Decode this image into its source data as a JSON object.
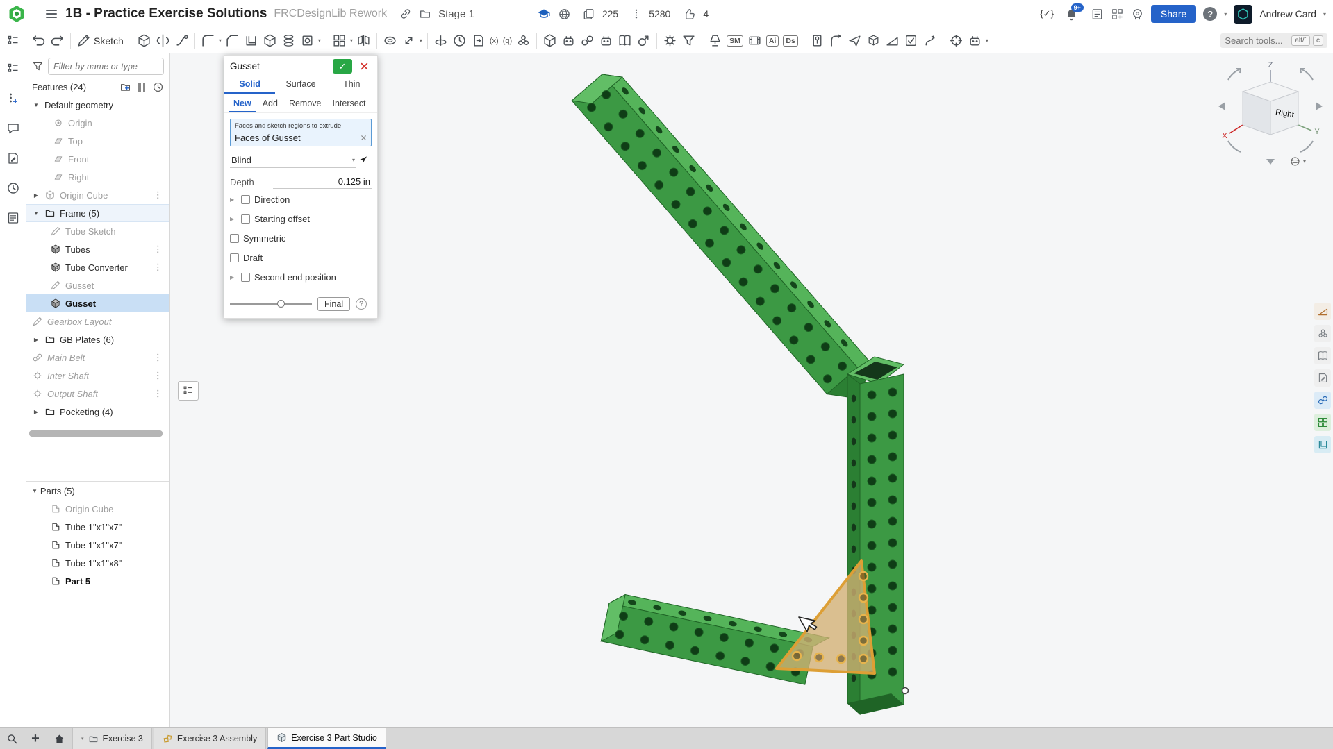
{
  "colors": {
    "accent_blue": "#2563c9",
    "selection_blue": "#c9dff5",
    "green_check": "#28a745",
    "red_close": "#d3302a",
    "model_green": "#3C9944",
    "model_green_light": "#55B45A",
    "model_green_dark": "#2B7F33",
    "gusset_gold": "#DD9F35",
    "education_blue": "#1b5fbd",
    "assembly_amber": "#c99b2f"
  },
  "icons": {
    "caret_small": "▾",
    "caret_down": "▼",
    "caret_right": "▶",
    "dots": "⋮",
    "check": "✓",
    "help": "?",
    "plus": "+",
    "script_check": "{✓}"
  },
  "topbar": {
    "title": "1B - Practice Exercise Solutions",
    "subtitle": "FRCDesignLib Rework",
    "stage": "Stage 1",
    "copies_count": "225",
    "uses_count": "5280",
    "likes_count": "4",
    "notification_badge": "9+",
    "share_label": "Share",
    "user_name": "Andrew Card"
  },
  "toolbar": {
    "search_placeholder": "Search tools...",
    "kbd1": "alt/`",
    "kbd2": "c",
    "icons": [
      {
        "name": "undo-icon",
        "sym": "sym-undo"
      },
      {
        "name": "redo-icon",
        "sym": "sym-redo",
        "div": true
      },
      {
        "name": "sketch-button",
        "sym": "sym-pencil",
        "label": "Sketch",
        "div": true
      },
      {
        "name": "extrude-icon",
        "sym": "sym-extrude"
      },
      {
        "name": "revolve-icon",
        "sym": "sym-revolve"
      },
      {
        "name": "sweep-icon",
        "sym": "sym-sweep",
        "div": true
      },
      {
        "name": "fillet-icon",
        "sym": "sym-fillet",
        "caret": true
      },
      {
        "name": "chamfer-icon",
        "sym": "sym-chamfer"
      },
      {
        "name": "shell-icon",
        "sym": "sym-shell"
      },
      {
        "name": "draft-icon",
        "sym": "sym-extrude"
      },
      {
        "name": "helix-icon",
        "sym": "sym-spring"
      },
      {
        "name": "hole-icon",
        "sym": "sym-hole",
        "caret": true,
        "div": true
      },
      {
        "name": "linear-pattern-icon",
        "sym": "sym-grid",
        "caret": true
      },
      {
        "name": "mirror-icon",
        "sym": "sym-mirror",
        "div": true
      },
      {
        "name": "boolean-icon",
        "sym": "sym-torus"
      },
      {
        "name": "transform-icon",
        "sym": "sym-transform",
        "caret": true,
        "div": true
      },
      {
        "name": "split-icon",
        "sym": "sym-split"
      },
      {
        "name": "modify-fillet-icon",
        "sym": "sym-clock"
      },
      {
        "name": "import-icon",
        "sym": "sym-import"
      },
      {
        "name": "variable-icon",
        "text": "(x)"
      },
      {
        "name": "lookup-table-icon",
        "text": "(q)"
      },
      {
        "name": "composite-part-icon",
        "sym": "sym-lattice",
        "div": true
      },
      {
        "name": "frame-feature-icon",
        "sym": "sym-cube"
      },
      {
        "name": "robot-feature-icon",
        "sym": "sym-robot"
      },
      {
        "name": "belt-feature-icon",
        "sym": "sym-rings"
      },
      {
        "name": "robot-feature-2-icon",
        "sym": "sym-robot"
      },
      {
        "name": "parts-library-icon",
        "sym": "sym-book"
      },
      {
        "name": "gear-generator-icon",
        "sym": "sym-geargender",
        "div": true
      },
      {
        "name": "settings-gear-icon",
        "sym": "sym-gear"
      },
      {
        "name": "filter-tools-icon",
        "sym": "sym-funnel",
        "div": true
      },
      {
        "name": "lamp-feature-icon",
        "sym": "sym-lamp"
      },
      {
        "name": "sheet-metal-icon",
        "text": "SM",
        "badge_cls": "boxed"
      },
      {
        "name": "animation-icon",
        "sym": "sym-film"
      },
      {
        "name": "ai-feature-icon",
        "text": "Ai",
        "badge_cls": "boxed"
      },
      {
        "name": "design-studio-icon",
        "text": "Ds",
        "badge_cls": "boxed",
        "div": true
      },
      {
        "name": "fasten-icon",
        "sym": "sym-fasten"
      },
      {
        "name": "bend-icon",
        "sym": "sym-bend"
      },
      {
        "name": "flatten-icon",
        "sym": "sym-plane"
      },
      {
        "name": "convert-icon",
        "sym": "sym-convert"
      },
      {
        "name": "wedge-icon",
        "sym": "sym-wedge"
      },
      {
        "name": "sketch-check-icon",
        "sym": "sym-checkbox"
      },
      {
        "name": "wire-icon",
        "sym": "sym-wire",
        "div": true
      },
      {
        "name": "origin-align-icon",
        "sym": "sym-target"
      },
      {
        "name": "robot-config-icon",
        "sym": "sym-robot",
        "caret": true
      }
    ]
  },
  "leftstrip": {
    "icons": [
      {
        "name": "configurations-icon",
        "sym": "sym-tree"
      },
      {
        "name": "insert-item-icon",
        "sym": "sym-dotsplus"
      },
      {
        "name": "comments-icon",
        "sym": "sym-comment"
      },
      {
        "name": "notes-icon",
        "sym": "sym-docedit"
      },
      {
        "name": "history-icon",
        "sym": "sym-clock"
      },
      {
        "name": "checklist-icon",
        "sym": "sym-list"
      }
    ]
  },
  "features": {
    "filter_placeholder": "Filter by name or type",
    "header": "Features (24)",
    "items": [
      {
        "name": "feature-default-geometry",
        "cls": "lvl0",
        "caret": "▼",
        "label": "Default geometry"
      },
      {
        "name": "feature-origin",
        "cls": "lvl2 grey",
        "sym": "fi-origin",
        "ico": "origin-icon",
        "label": "Origin"
      },
      {
        "name": "feature-plane-top",
        "cls": "lvl2 grey",
        "sym": "fi-plane",
        "ico": "plane-icon",
        "label": "Top"
      },
      {
        "name": "feature-plane-front",
        "cls": "lvl2 grey",
        "sym": "fi-plane",
        "ico": "plane-icon",
        "label": "Front"
      },
      {
        "name": "feature-plane-right",
        "cls": "lvl2 grey",
        "sym": "fi-plane",
        "ico": "plane-icon",
        "label": "Right"
      },
      {
        "name": "feature-origin-cube",
        "cls": "lvl0 grey",
        "caret": "▶",
        "sym": "fi-cube",
        "ico": "cube-icon",
        "label": "Origin Cube",
        "dots": true
      },
      {
        "name": "feature-folder-frame",
        "cls": "lvl0 hl",
        "caret": "▼",
        "sym": "fi-folder",
        "ico": "folder-icon",
        "label": "Frame (5)"
      },
      {
        "name": "feature-tube-sketch",
        "cls": "lvl1 grey",
        "sym": "fi-pencil",
        "ico": "sketch-icon",
        "label": "Tube Sketch"
      },
      {
        "name": "feature-tubes",
        "cls": "lvl1",
        "sym": "fi-extrude",
        "ico": "extrude-icon",
        "label": "Tubes",
        "dots": true
      },
      {
        "name": "feature-tube-converter",
        "cls": "lvl1",
        "sym": "fi-converter",
        "ico": "converter-icon",
        "label": "Tube Converter",
        "dots": true
      },
      {
        "name": "feature-gusset-sketch",
        "cls": "lvl1 grey",
        "sym": "fi-pencil",
        "ico": "sketch-icon",
        "label": "Gusset"
      },
      {
        "name": "feature-gusset-extrude",
        "cls": "lvl1 sel bold",
        "sym": "fi-extrude",
        "ico": "extrude-icon",
        "label": "Gusset"
      },
      {
        "name": "feature-gearbox-layout",
        "cls": "lvl0 grey italic",
        "sym": "fi-pencil",
        "ico": "sketch-icon",
        "label": "Gearbox Layout"
      },
      {
        "name": "feature-folder-gb-plates",
        "cls": "lvl0",
        "caret": "▶",
        "sym": "fi-folder",
        "ico": "folder-icon",
        "label": "GB Plates (6)"
      },
      {
        "name": "feature-main-belt",
        "cls": "lvl0 grey italic",
        "sym": "fi-belt",
        "ico": "belt-icon",
        "label": "Main Belt",
        "dots": true
      },
      {
        "name": "feature-inter-shaft",
        "cls": "lvl0 grey italic",
        "sym": "fi-gear",
        "ico": "gear-icon",
        "label": "Inter Shaft",
        "dots": true
      },
      {
        "name": "feature-output-shaft",
        "cls": "lvl0 grey italic",
        "sym": "fi-gear",
        "ico": "gear-icon",
        "label": "Output Shaft",
        "dots": true
      },
      {
        "name": "feature-folder-pocketing",
        "cls": "lvl0",
        "caret": "▶",
        "sym": "fi-folder",
        "ico": "folder-icon",
        "label": "Pocketing (4)"
      }
    ]
  },
  "parts": {
    "header": "Parts (5)",
    "items": [
      {
        "name": "part-origin-cube",
        "cls": "lvl1 grey",
        "sym": "fi-part",
        "ico": "part-icon",
        "label": "Origin Cube"
      },
      {
        "name": "part-tube-1x1x7-a",
        "cls": "lvl1",
        "sym": "fi-part",
        "ico": "part-icon",
        "label": "Tube 1\"x1\"x7\""
      },
      {
        "name": "part-tube-1x1x7-b",
        "cls": "lvl1",
        "sym": "fi-part",
        "ico": "part-icon",
        "label": "Tube 1\"x1\"x7\""
      },
      {
        "name": "part-tube-1x1x8",
        "cls": "lvl1",
        "sym": "fi-part",
        "ico": "part-icon",
        "label": "Tube 1\"x1\"x8\""
      },
      {
        "name": "part-5",
        "cls": "lvl1 bold",
        "sym": "fi-part",
        "ico": "part-icon",
        "label": "Part 5"
      }
    ]
  },
  "dialog": {
    "title": "Gusset",
    "tabs": [
      {
        "name": "dialog-tab-solid",
        "label": "Solid",
        "cls": "active"
      },
      {
        "name": "dialog-tab-surface",
        "label": "Surface"
      },
      {
        "name": "dialog-tab-thin",
        "label": "Thin"
      }
    ],
    "subtabs": [
      {
        "name": "dialog-subtab-new",
        "label": "New",
        "cls": "active"
      },
      {
        "name": "dialog-subtab-add",
        "label": "Add"
      },
      {
        "name": "dialog-subtab-remove",
        "label": "Remove"
      },
      {
        "name": "dialog-subtab-intersect",
        "label": "Intersect"
      }
    ],
    "selection_label": "Faces and sketch regions to extrude",
    "selection_value": "Faces of Gusset",
    "end_type": "Blind",
    "depth_label": "Depth",
    "depth_value": "0.125 in",
    "options": [
      {
        "label": "Direction"
      },
      {
        "label": "Starting offset"
      },
      {
        "label": "Symmetric"
      },
      {
        "label": "Draft"
      },
      {
        "label": "Second end position"
      }
    ],
    "final_label": "Final"
  },
  "viewcube": {
    "face": "Right",
    "x": "X",
    "y": "Y",
    "z": "Z"
  },
  "rightdock": {
    "items": [
      {
        "name": "dock-ramp-icon",
        "sym": "sym-wedge",
        "color": "#f3ede5",
        "fg": "#b06f2f"
      },
      {
        "name": "dock-stock-parts-icon",
        "sym": "sym-lattice",
        "color": "#efefef",
        "fg": "#7a7f84"
      },
      {
        "name": "dock-library-icon",
        "sym": "sym-book",
        "color": "#efefef",
        "fg": "#7a7f84"
      },
      {
        "name": "dock-clipboard-icon",
        "sym": "sym-docedit",
        "color": "#efefef",
        "fg": "#7a7f84"
      },
      {
        "name": "dock-goggles-icon",
        "sym": "sym-rings",
        "color": "#dcebf7",
        "fg": "#2b6cb8"
      },
      {
        "name": "dock-workbench-icon",
        "sym": "sym-grid",
        "color": "#ddefdd",
        "fg": "#2e8b3a"
      },
      {
        "name": "dock-panel-icon",
        "sym": "sym-shell",
        "color": "#d8ecf4",
        "fg": "#2b8a9a"
      }
    ]
  },
  "bottombar": {
    "tabs": [
      {
        "label": "Exercise 3"
      },
      {
        "label": "Exercise 3 Assembly"
      },
      {
        "label": "Exercise 3 Part Studio"
      }
    ]
  }
}
